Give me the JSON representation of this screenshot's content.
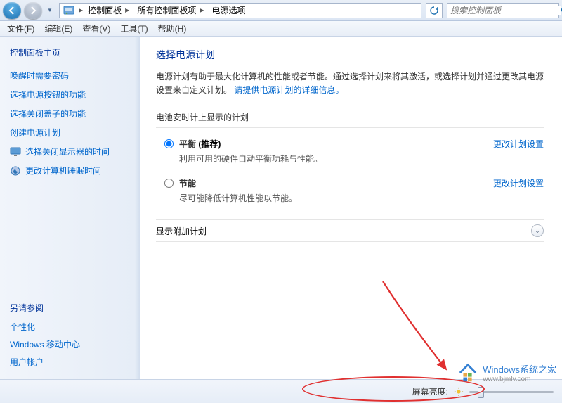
{
  "titlebar": {
    "breadcrumb": [
      "控制面板",
      "所有控制面板项",
      "电源选项"
    ],
    "search_placeholder": "搜索控制面板"
  },
  "menubar": {
    "items": [
      "文件(F)",
      "编辑(E)",
      "查看(V)",
      "工具(T)",
      "帮助(H)"
    ]
  },
  "sidebar": {
    "home": "控制面板主页",
    "links": [
      "唤醒时需要密码",
      "选择电源按钮的功能",
      "选择关闭盖子的功能",
      "创建电源计划",
      "选择关闭显示器的时间",
      "更改计算机睡眠时间"
    ],
    "see_also_title": "另请参阅",
    "see_also": [
      "个性化",
      "Windows 移动中心",
      "用户帐户"
    ]
  },
  "main": {
    "title": "选择电源计划",
    "desc_pre": "电源计划有助于最大化计算机的性能或者节能。通过选择计划来将其激活，或选择计划并通过更改其电源设置来自定义计划。",
    "desc_link": "请提供电源计划的详细信息。",
    "group_title": "电池安时计上显示的计划",
    "plans": [
      {
        "name": "平衡",
        "rec": " (推荐)",
        "desc": "利用可用的硬件自动平衡功耗与性能。",
        "selected": true
      },
      {
        "name": "节能",
        "rec": "",
        "desc": "尽可能降低计算机性能以节能。",
        "selected": false
      }
    ],
    "change_label": "更改计划设置",
    "expander": "显示附加计划"
  },
  "bottom": {
    "brightness_label": "屏幕亮度:"
  },
  "watermark": {
    "line1": "Windows系统之家",
    "line2": "www.bjmlv.com"
  }
}
